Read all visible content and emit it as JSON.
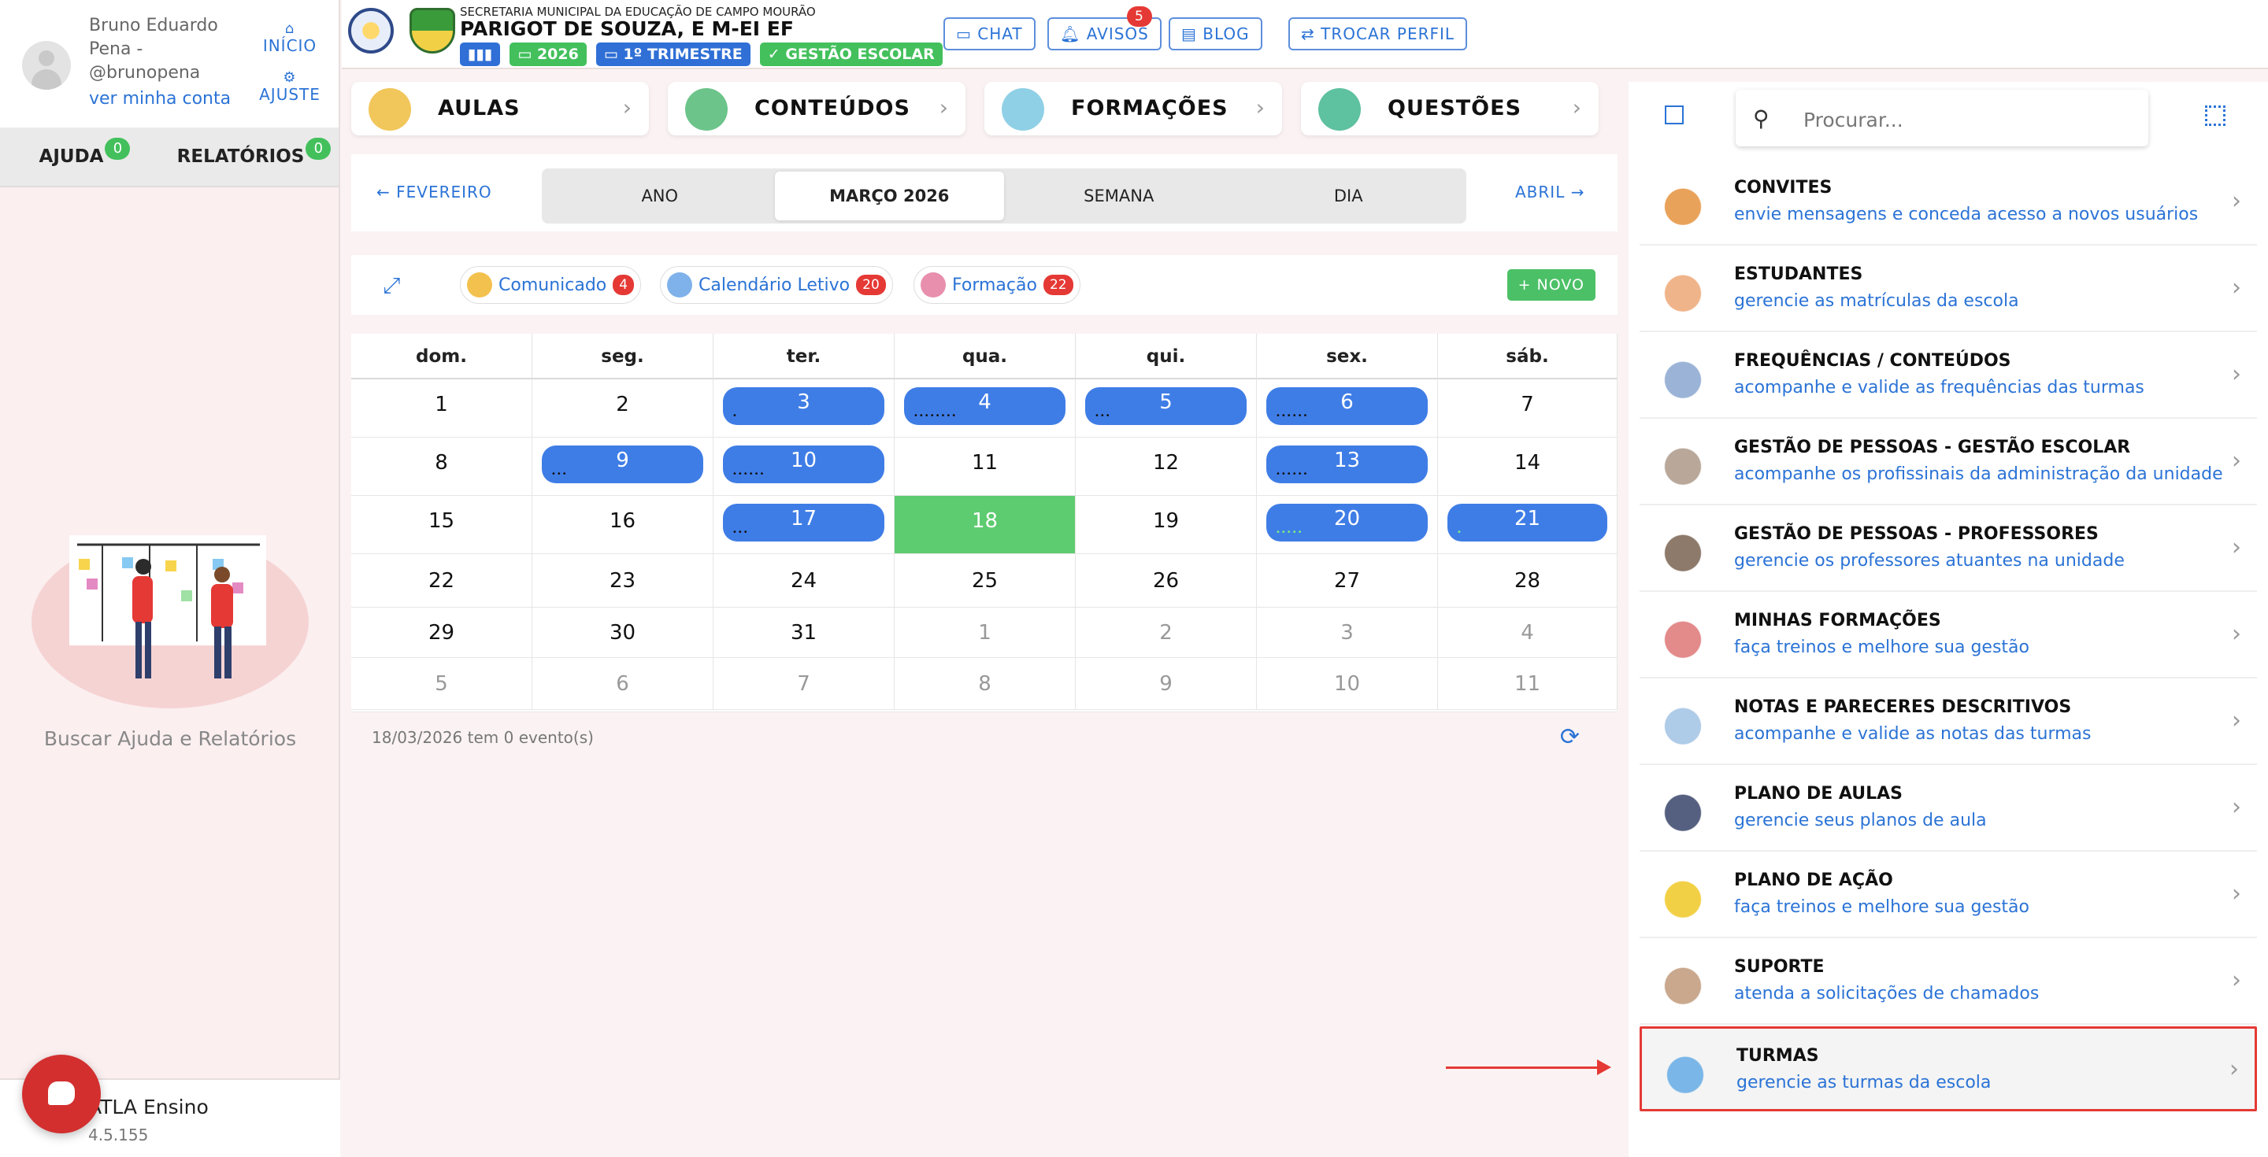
{
  "sidebar": {
    "user_name": "Bruno Eduardo Pena - @brunopena",
    "user_link": "ver minha conta",
    "nav_home": "INÍCIO",
    "nav_settings": "AJUSTE",
    "help_label": "AJUDA",
    "help_count": "0",
    "reports_label": "RELATÓRIOS",
    "reports_count": "0",
    "caption": "Buscar Ajuda e Relatórios",
    "app_name": "ATLA Ensino",
    "app_version": "4.5.155"
  },
  "header": {
    "secretaria": "SECRETARIA MUNICIPAL DA EDUCAÇÃO DE CAMPO MOURÃO",
    "school": "PARIGOT DE SOUZA, E M-EI EF",
    "year": "2026",
    "term": "1º TRIMESTRE",
    "role": "GESTÃO ESCOLAR",
    "chat": "CHAT",
    "avisos": "AVISOS",
    "avisos_count": "5",
    "blog": "BLOG",
    "trocar": "TROCAR PERFIL"
  },
  "categories": [
    "AULAS",
    "CONTEÚDOS",
    "FORMAÇÕES",
    "QUESTÕES"
  ],
  "calendar_nav": {
    "prev": "FEVEREIRO",
    "next": "ABRIL",
    "views": [
      "ANO",
      "MARÇO 2026",
      "SEMANA",
      "DIA"
    ]
  },
  "filters": {
    "chips": [
      {
        "label": "Comunicado",
        "count": "4"
      },
      {
        "label": "Calendário Letivo",
        "count": "20"
      },
      {
        "label": "Formação",
        "count": "22"
      }
    ],
    "new_button": "NOVO"
  },
  "calendar": {
    "weekdays": [
      "dom.",
      "seg.",
      "ter.",
      "qua.",
      "qui.",
      "sex.",
      "sáb."
    ],
    "weeks": [
      [
        "1",
        "2",
        "3",
        "4",
        "5",
        "6",
        "7"
      ],
      [
        "8",
        "9",
        "10",
        "11",
        "12",
        "13",
        "14"
      ],
      [
        "15",
        "16",
        "17",
        "18",
        "19",
        "20",
        "21"
      ],
      [
        "22",
        "23",
        "24",
        "25",
        "26",
        "27",
        "28"
      ],
      [
        "29",
        "30",
        "31",
        "1",
        "2",
        "3",
        "4"
      ],
      [
        "5",
        "6",
        "7",
        "8",
        "9",
        "10",
        "11"
      ]
    ],
    "footer": "18/03/2026 tem 0 evento(s)"
  },
  "search": {
    "placeholder": "Procurar..."
  },
  "menu": [
    {
      "title": "CONVITES",
      "subtitle": "envie mensagens e conceda acesso a novos usuários"
    },
    {
      "title": "ESTUDANTES",
      "subtitle": "gerencie as matrículas da escola"
    },
    {
      "title": "FREQUÊNCIAS / CONTEÚDOS",
      "subtitle": "acompanhe e valide as frequências das turmas"
    },
    {
      "title": "GESTÃO DE PESSOAS - GESTÃO ESCOLAR",
      "subtitle": "acompanhe os profissinais da administração da unidade"
    },
    {
      "title": "GESTÃO DE PESSOAS - PROFESSORES",
      "subtitle": "gerencie os professores atuantes na unidade"
    },
    {
      "title": "MINHAS FORMAÇÕES",
      "subtitle": "faça treinos e melhore sua gestão"
    },
    {
      "title": "NOTAS E PARECERES DESCRITIVOS",
      "subtitle": "acompanhe e valide as notas das turmas"
    },
    {
      "title": "PLANO DE AULAS",
      "subtitle": "gerencie seus planos de aula"
    },
    {
      "title": "PLANO DE AÇÃO",
      "subtitle": "faça treinos e melhore sua gestão"
    },
    {
      "title": "SUPORTE",
      "subtitle": "atenda a solicitações de chamados"
    },
    {
      "title": "TURMAS",
      "subtitle": "gerencie as turmas da escola"
    }
  ],
  "colors": {
    "accent": "#2b73d6",
    "event": "#3f7de6",
    "today": "#5dcb6f",
    "highlight": "#e53935"
  }
}
